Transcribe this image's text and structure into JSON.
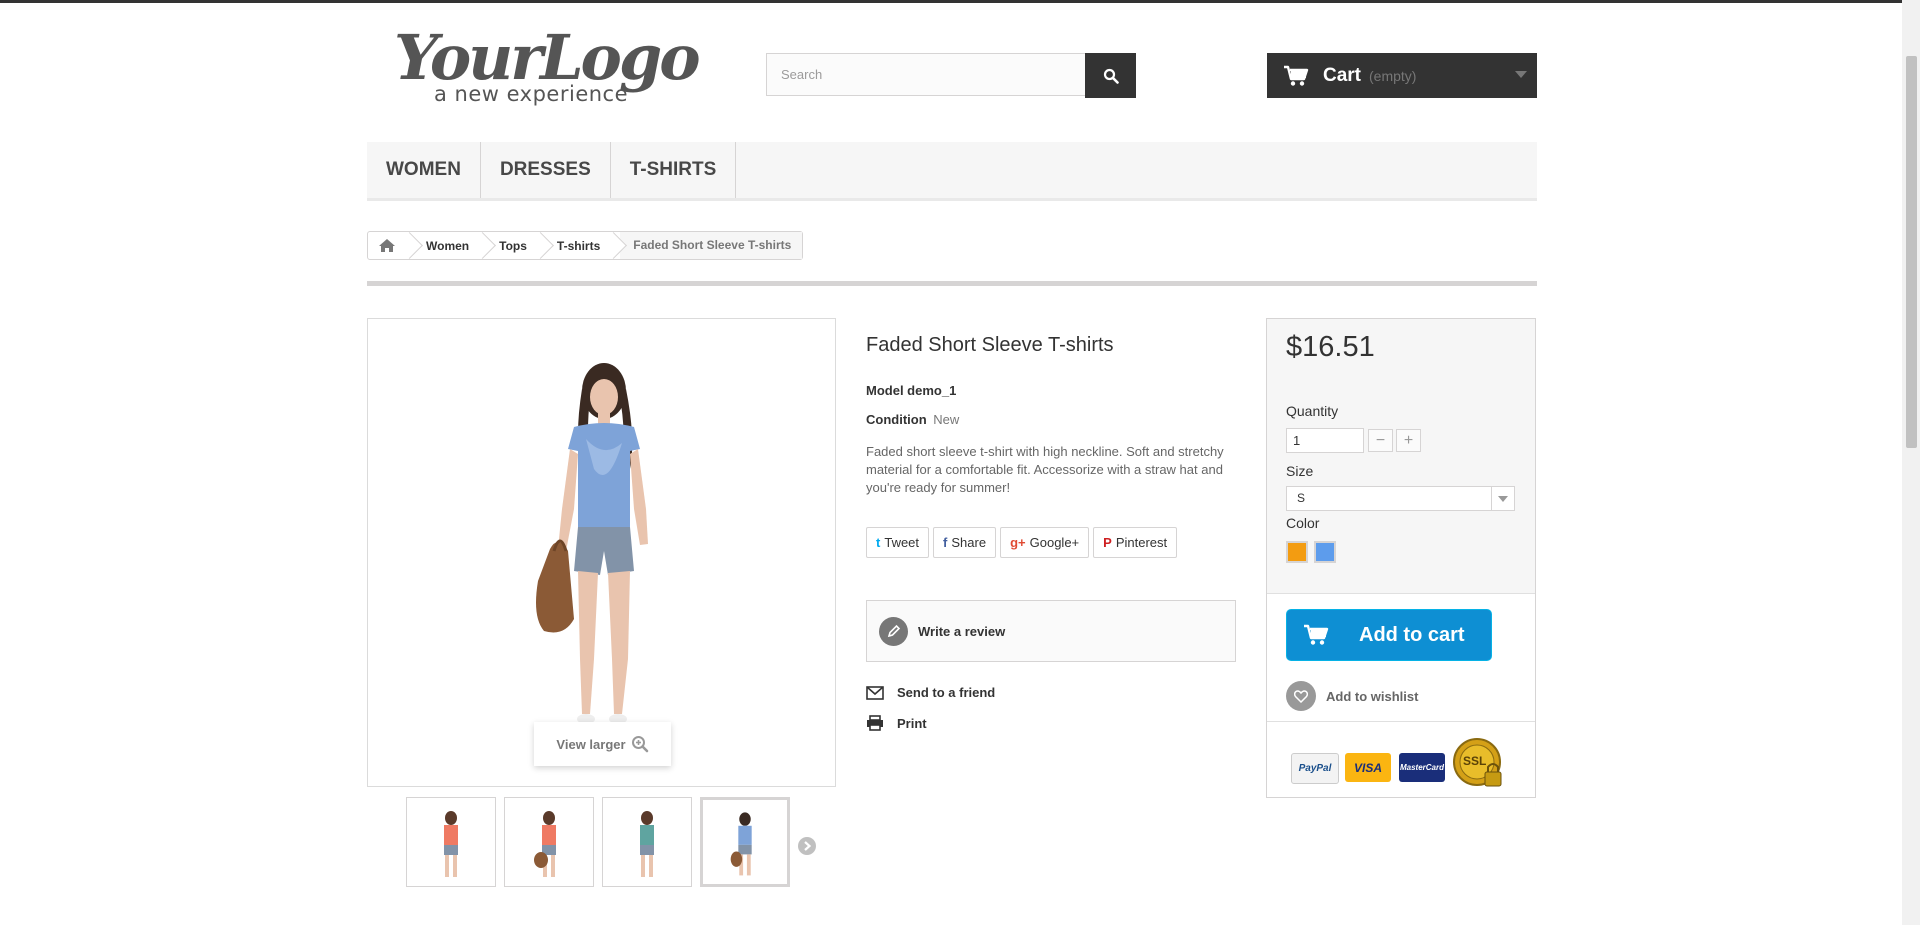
{
  "logo": {
    "script": "YourLogo",
    "tagline": "a new experience"
  },
  "search": {
    "placeholder": "Search",
    "value": ""
  },
  "cart": {
    "label": "Cart",
    "status": "(empty)"
  },
  "menu": {
    "items": [
      {
        "label": "Women"
      },
      {
        "label": "Dresses"
      },
      {
        "label": "T-shirts"
      }
    ]
  },
  "breadcrumb": {
    "items": [
      "Women",
      "Tops",
      "T-shirts"
    ],
    "current": "Faded Short Sleeve T-shirts"
  },
  "main_image": {
    "view_larger": "View larger",
    "active_thumb_index": 3,
    "thumb_count": 4
  },
  "product": {
    "title": "Faded Short Sleeve T-shirts",
    "model": "Model demo_1",
    "condition_label": "Condition",
    "condition_value": "New",
    "description": "Faded short sleeve t-shirt with high neckline. Soft and stretchy material for a comfortable fit. Accessorize with a straw hat and you're ready for summer!"
  },
  "social": [
    {
      "icon": "twitter-icon",
      "glyph": "t",
      "label": "Tweet",
      "color": "#00aaf0"
    },
    {
      "icon": "facebook-icon",
      "glyph": "f",
      "label": "Share",
      "color": "#435f9f"
    },
    {
      "icon": "google-plus-icon",
      "glyph": "g+",
      "label": "Google+",
      "color": "#e04b34"
    },
    {
      "icon": "pinterest-icon",
      "glyph": "P",
      "label": "Pinterest",
      "color": "#ce1f21"
    }
  ],
  "actions": {
    "write_review": "Write a review",
    "send_friend": "Send to a friend",
    "print": "Print"
  },
  "buy": {
    "price": "$16.51",
    "quantity_label": "Quantity",
    "quantity_value": "1",
    "size_label": "Size",
    "size_value": "S",
    "color_label": "Color",
    "colors": [
      {
        "name": "Orange",
        "hex": "#f39c11"
      },
      {
        "name": "Blue",
        "hex": "#5d9cec"
      }
    ],
    "add_to_cart": "Add to cart",
    "add_to_wishlist": "Add to wishlist",
    "accent_color": "#0e8fd3"
  },
  "payment": {
    "paypal": "PayPal",
    "visa": "VISA",
    "mastercard": "MasterCard",
    "ssl": "SSL"
  }
}
